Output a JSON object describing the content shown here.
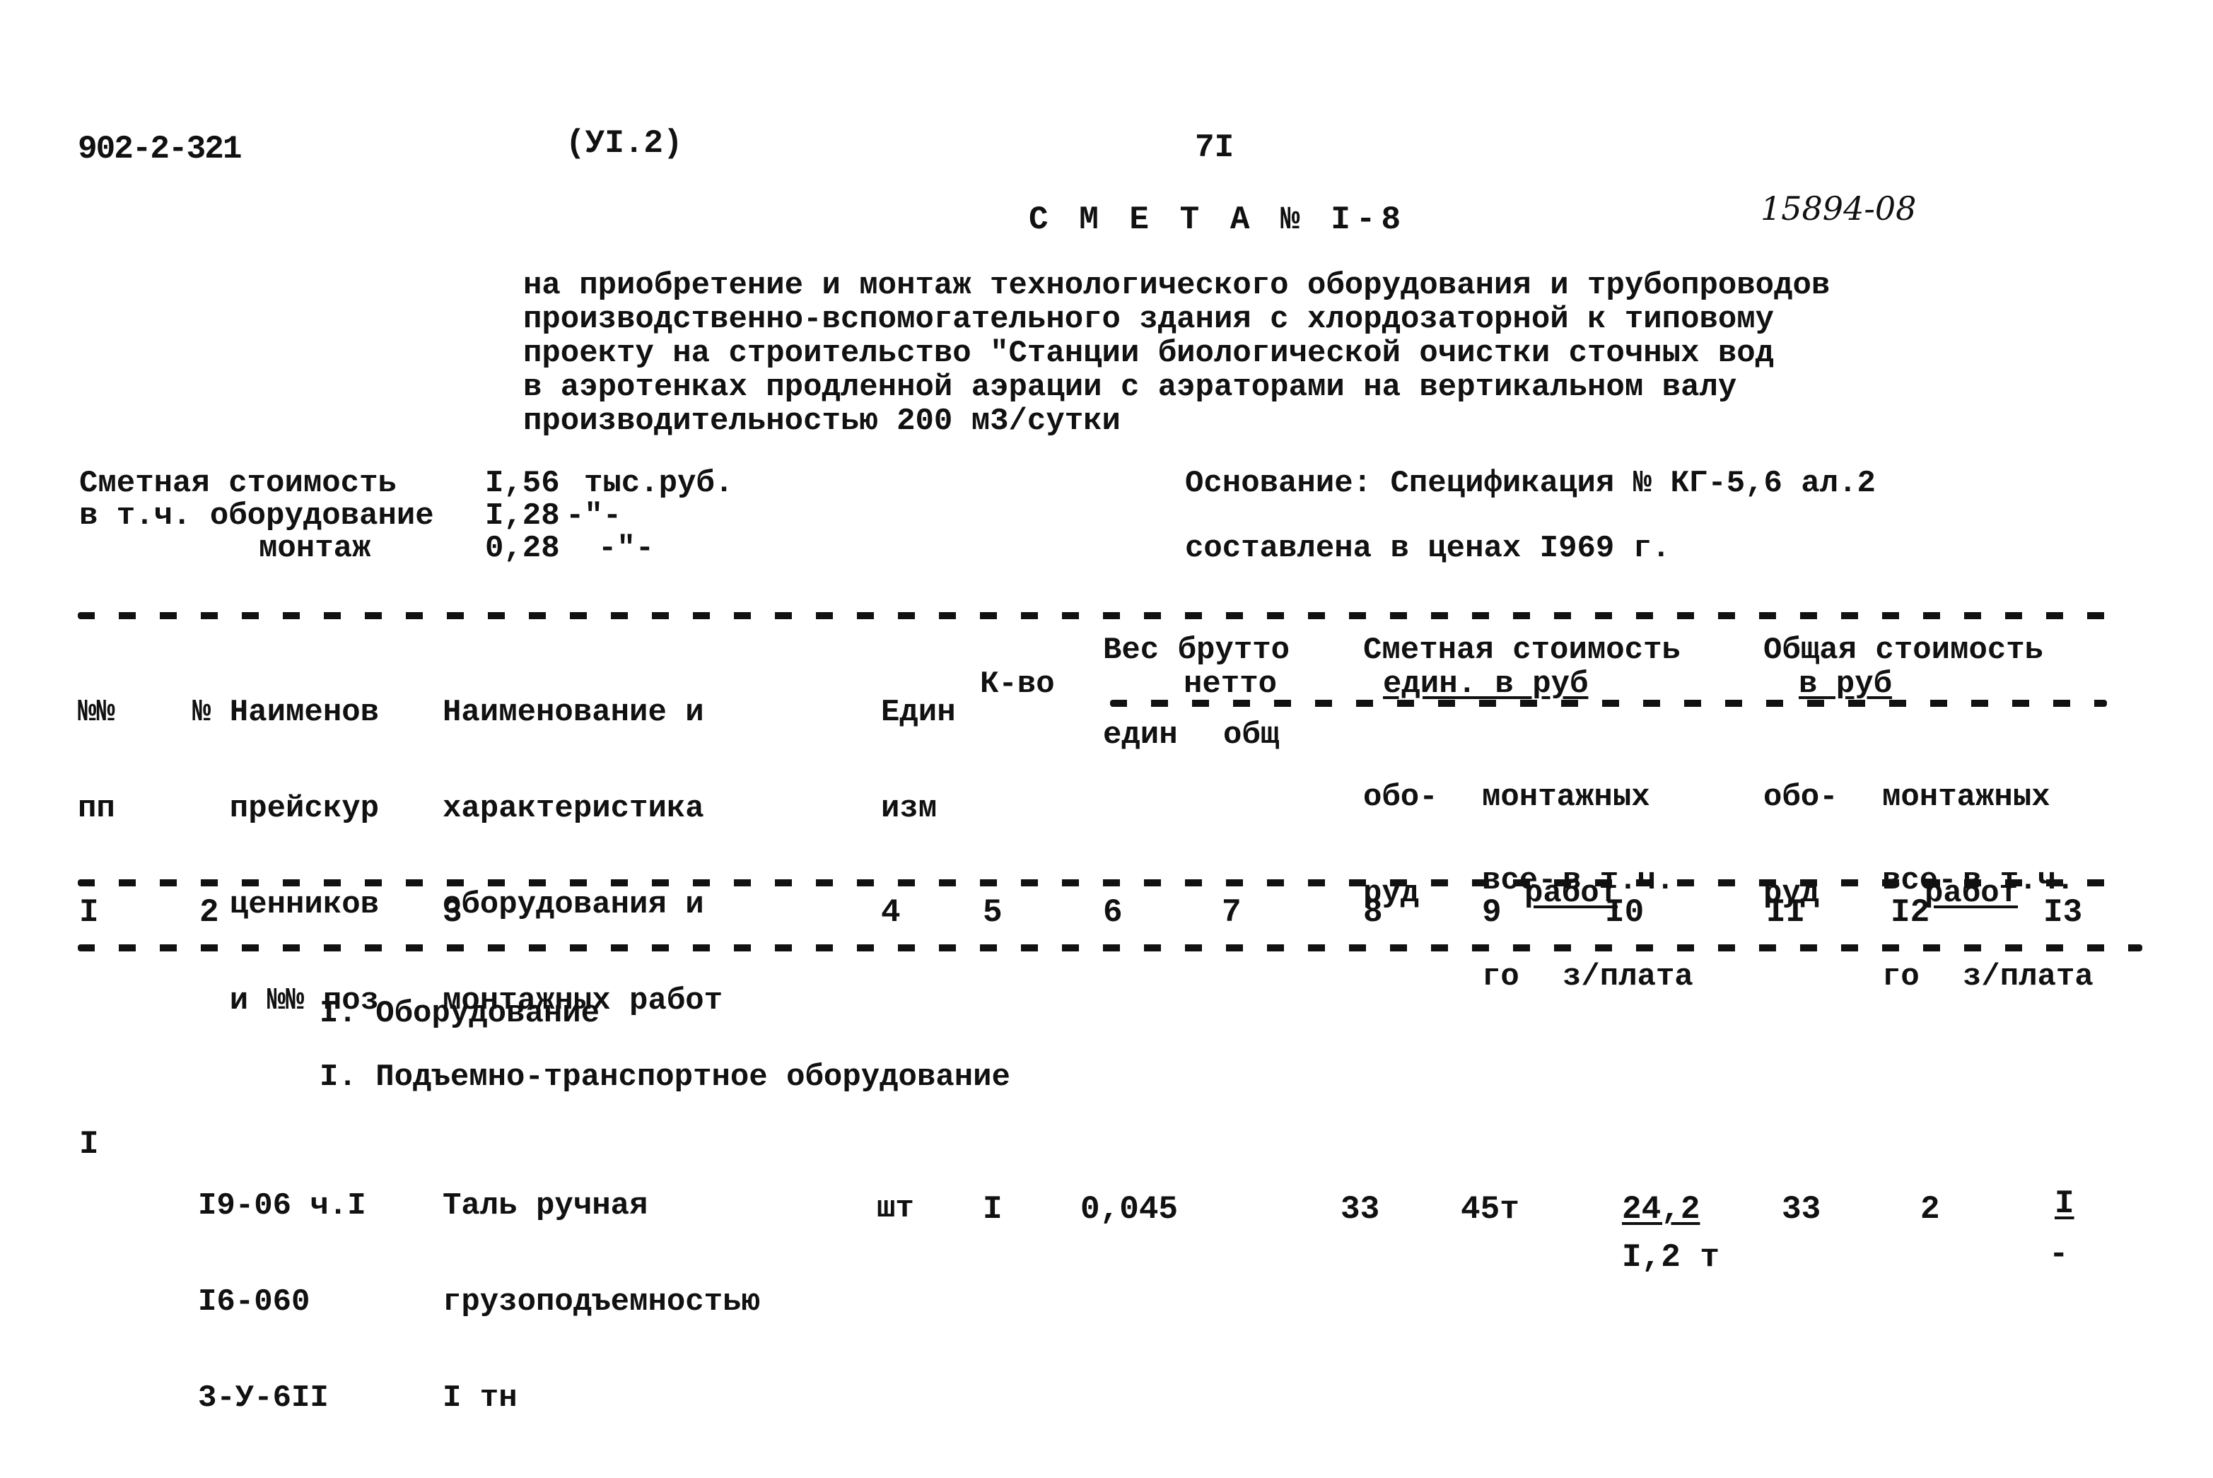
{
  "header": {
    "doc_code": "902-2-321",
    "album": "(УI.2)",
    "page_number": "7I",
    "title": "С М Е Т А № I-8",
    "handwritten_number": "15894-08"
  },
  "description": [
    "на приобретение и монтаж технологического оборудования и трубопроводов",
    "производственно-вспомогательного здания с хлордозаторной к типовому",
    "проекту на строительство \"Станции биологической очистки сточных вод",
    "в аэротенках продленной аэрации с аэраторами на вертикальном валу",
    "производительностью 200 м3/сутки"
  ],
  "summary": {
    "total_label": "Сметная стоимость",
    "total_value": "I,56",
    "total_unit": "тыс.руб.",
    "equipment_label": "в т.ч. оборудование",
    "equipment_value": "I,28",
    "equipment_unit": "-\"-",
    "installation_label": "монтаж",
    "installation_value": "0,28",
    "installation_unit": "-\"-",
    "basis": "Основание: Спецификация № КГ-5,6 ал.2",
    "prices": "составлена в ценах I969 г."
  },
  "table": {
    "headers": {
      "col1": [
        "№№",
        "пп"
      ],
      "col2": [
        "№ Наименов",
        "  прейскур",
        "  ценников",
        "  и №№ поз"
      ],
      "col3": [
        "Наименование и",
        "характеристика",
        "оборудования и",
        "монтажных работ"
      ],
      "col4": [
        "Един",
        "изм"
      ],
      "col5": "К-во",
      "weight_group": "Вес брутто",
      "weight_sub": "нетто",
      "col6": "един",
      "col7": "общ",
      "unit_cost_group": "Сметная стоимость",
      "unit_cost_sub": "един. в руб",
      "total_cost_group": "Общая стоимость",
      "total_cost_sub": "в руб",
      "equip": [
        "обо-",
        "руд"
      ],
      "install": [
        "монтажных",
        "работ"
      ],
      "install_all": [
        "все-",
        "го"
      ],
      "install_wage": [
        "в т.ч.",
        "з/плата"
      ]
    },
    "column_numbers": [
      "I",
      "2",
      "3",
      "4",
      "5",
      "6",
      "7",
      "8",
      "9",
      "I0",
      "II",
      "I2",
      "I3"
    ],
    "section": "I. Оборудование",
    "subsection": "I. Подъемно-транспортное оборудование",
    "rows": [
      {
        "num": "I",
        "price_refs": [
          "I9-06 ч.I",
          "I6-060",
          "3-У-6II"
        ],
        "name": [
          "Таль ручная",
          "грузоподъемностью",
          "I тн"
        ],
        "unit": "шт",
        "qty": "I",
        "weight_unit": "0,045",
        "weight_total": "",
        "unit_equip": "33",
        "unit_install_total": "45т",
        "unit_install_wage": "24,2",
        "unit_install_wage_sub": "I,2 т",
        "total_equip": "33",
        "total_install_total": "2",
        "total_install_wage": "I",
        "total_install_wage_sub": "-"
      }
    ]
  }
}
